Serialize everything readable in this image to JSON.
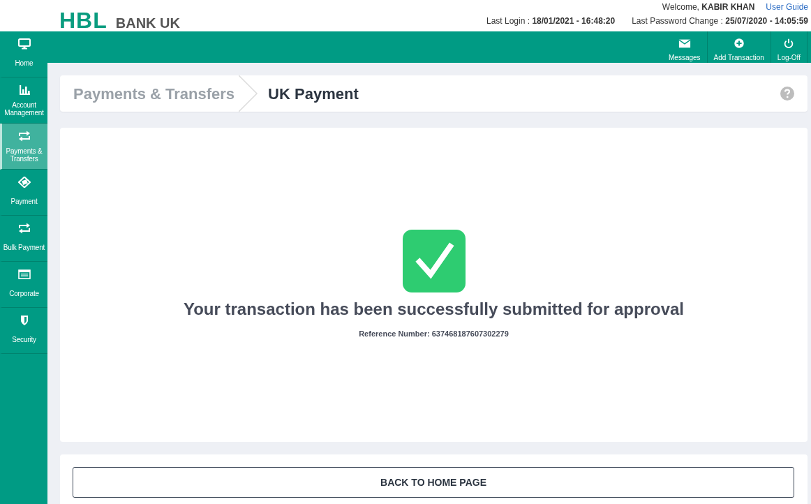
{
  "header": {
    "logo": {
      "mark": "HBL",
      "name": "BANK UK"
    },
    "welcome": "Welcome, **KABIR KHAN**",
    "user_guide": "User Guide",
    "last_login": "Last Login : **18/01/2021 - 16:48:20**",
    "last_password_change": "Last Password Change : **25/07/2020 - 14:05:59**"
  },
  "toolbar": [
    "Messages",
    "Add Transaction",
    "Log-Off"
  ],
  "sidebar": {
    "items": [
      {
        "label": "Home",
        "selected": false
      },
      {
        "label": "Account Management",
        "selected": false
      },
      {
        "label": "Payments & Transfers",
        "selected": true
      },
      {
        "label": "Payment",
        "selected": false
      },
      {
        "label": "Bulk Payment",
        "selected": false
      },
      {
        "label": "Corporate",
        "selected": false
      },
      {
        "label": "Security",
        "selected": false
      }
    ]
  },
  "breadcrumb": [
    {
      "label": "Payments & Transfers",
      "current": false
    },
    {
      "label": "UK Payment",
      "current": true
    }
  ],
  "result": {
    "message": "Your transaction has been successfully submitted for approval",
    "reference": "Reference Number: 637468187607302279"
  },
  "actions": {
    "back_button": "BACK TO HOME PAGE"
  }
}
